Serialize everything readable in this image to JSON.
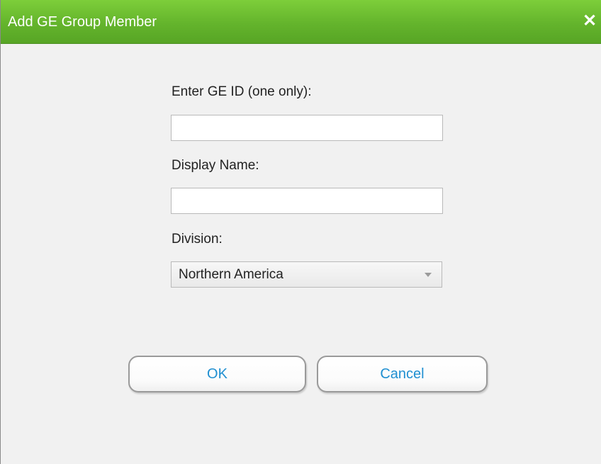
{
  "dialog": {
    "title": "Add GE Group Member",
    "close_symbol": "✕"
  },
  "form": {
    "ge_id": {
      "label": "Enter GE ID (one only):",
      "value": "",
      "placeholder": ""
    },
    "display_name": {
      "label": "Display Name:",
      "value": "",
      "placeholder": ""
    },
    "division": {
      "label": "Division:",
      "selected": "Northern America"
    }
  },
  "buttons": {
    "ok_label": "OK",
    "cancel_label": "Cancel"
  },
  "colors": {
    "titlebar": "#64b42c",
    "button_text": "#1f8fd1",
    "background": "#f1f1f1"
  }
}
